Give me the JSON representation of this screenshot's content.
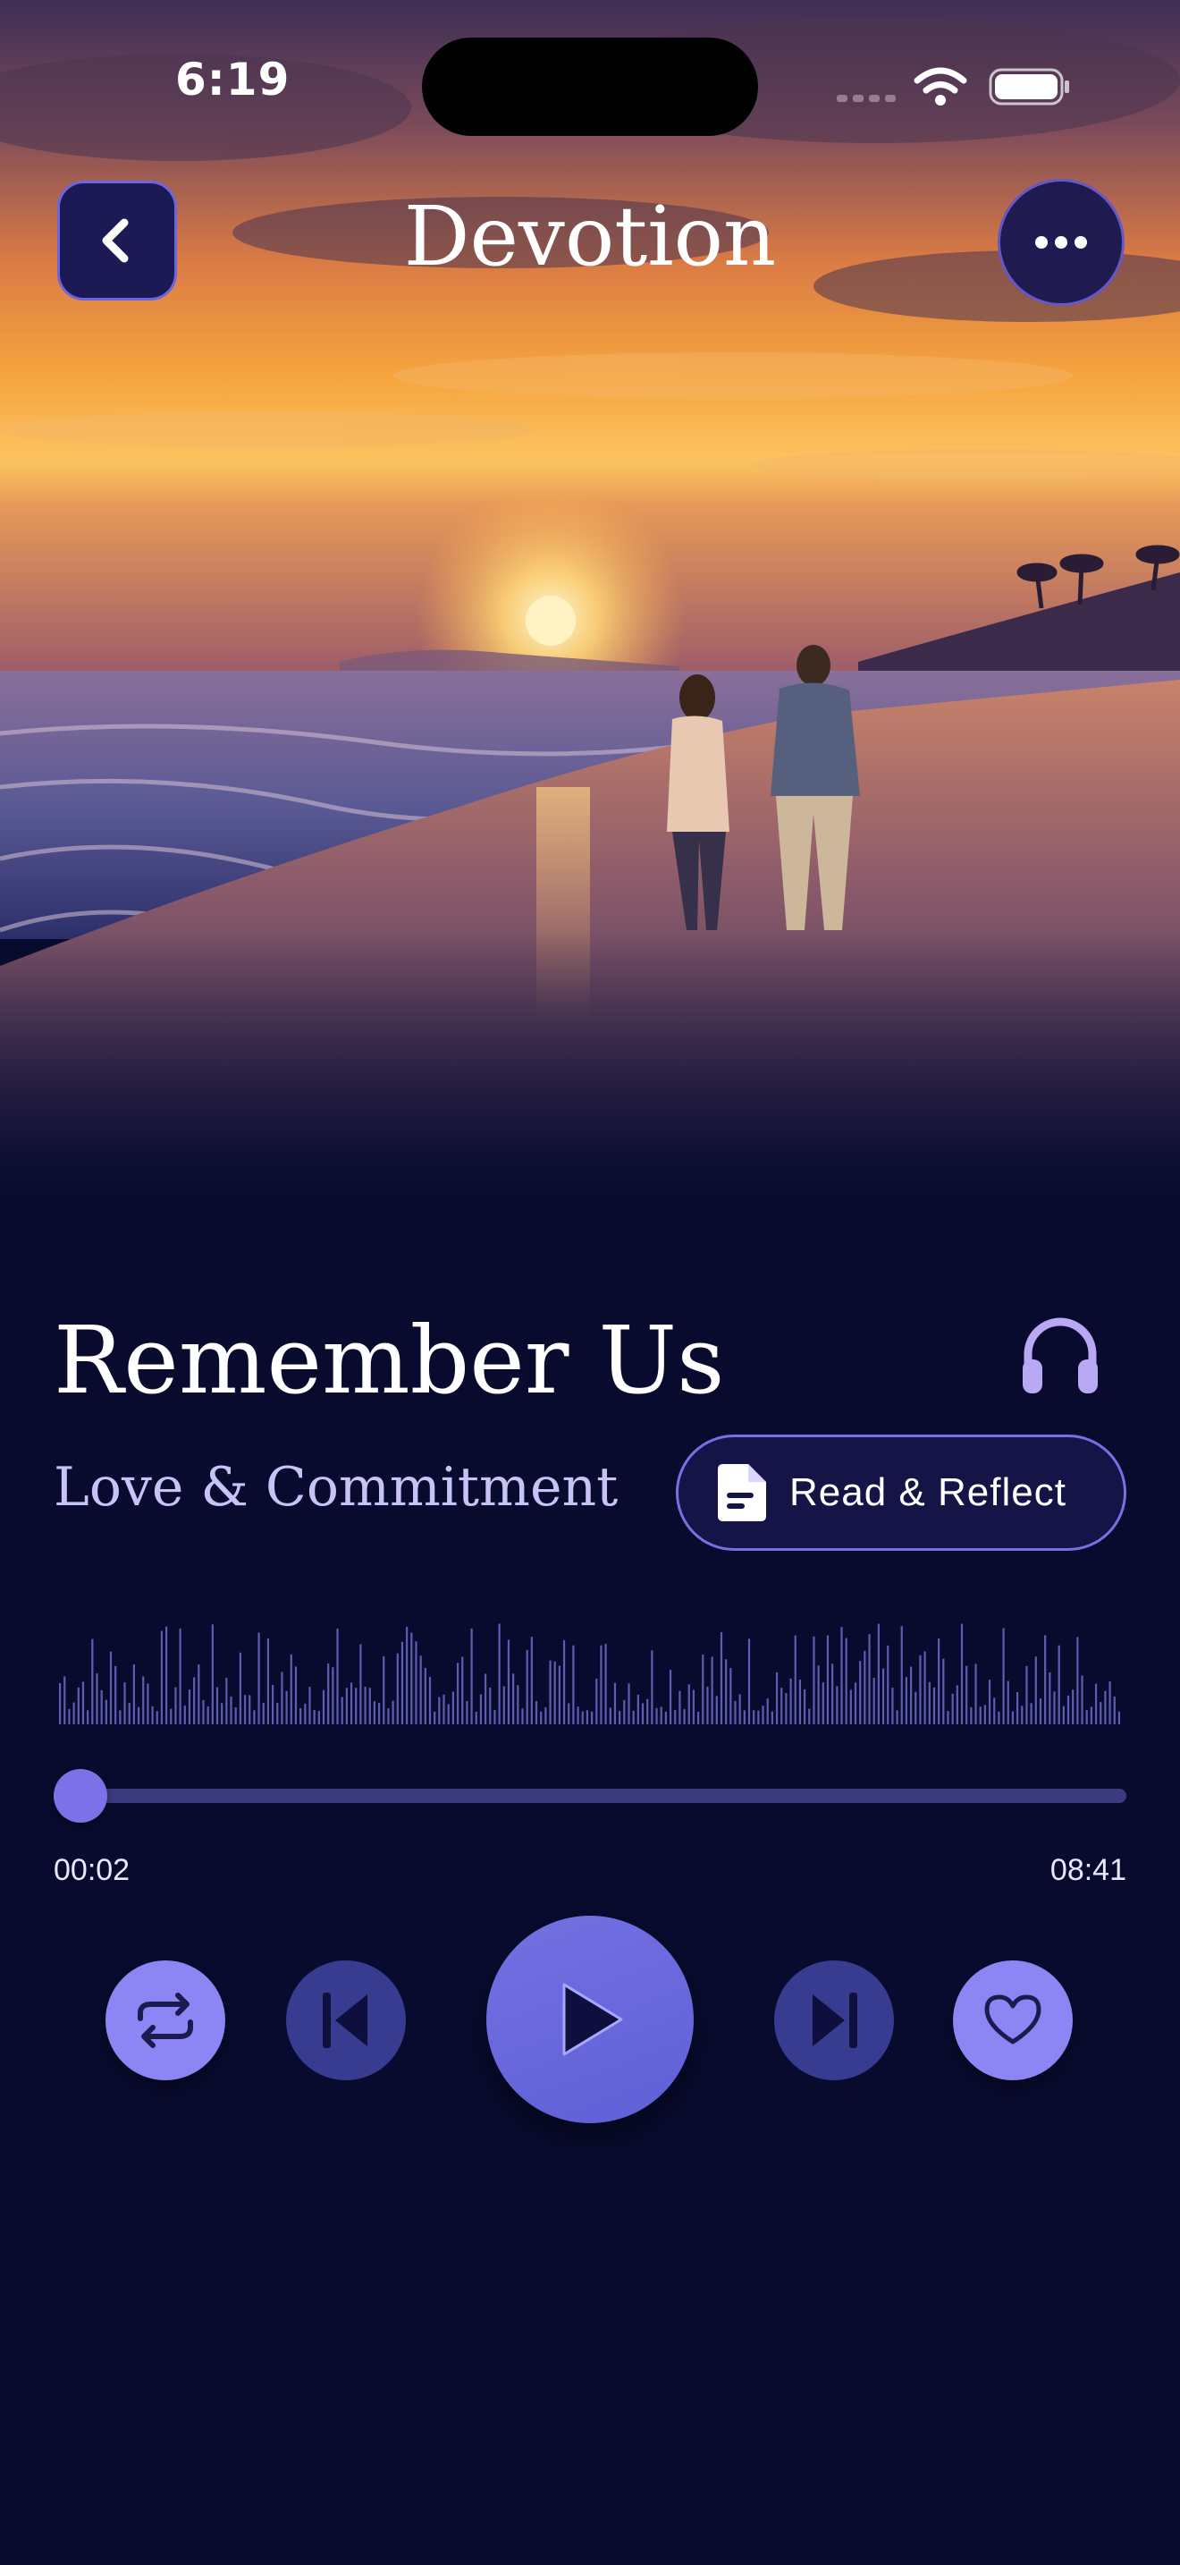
{
  "status_bar": {
    "time": "6:19"
  },
  "header": {
    "title": "Devotion",
    "back_icon": "chevron-left-icon",
    "more_icon": "ellipsis-icon"
  },
  "track": {
    "title": "Remember Us",
    "subtitle": "Love & Commitment",
    "headphones_icon": "headphones-icon",
    "read_button_label": "Read & Reflect",
    "read_button_icon": "document-icon"
  },
  "player": {
    "elapsed": "00:02",
    "duration": "08:41",
    "progress_fraction": 0.004,
    "controls": [
      "repeat-icon",
      "skip-previous-icon",
      "play-icon",
      "skip-next-icon",
      "heart-icon"
    ]
  },
  "colors": {
    "background": "#080b2e",
    "accent": "#7b6ee8",
    "accent_light": "#8b86f4",
    "subtitle": "#c8c2f6"
  }
}
